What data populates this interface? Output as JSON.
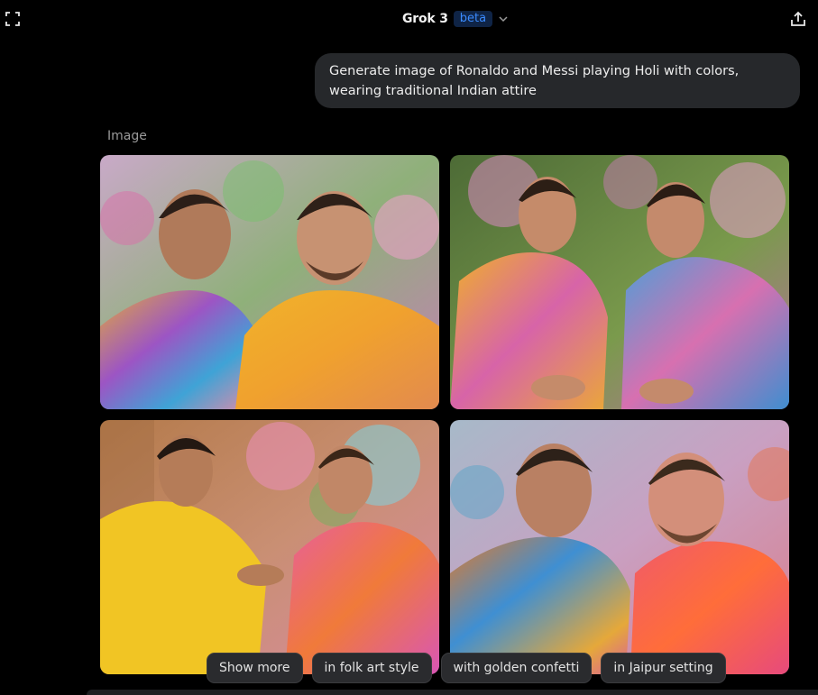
{
  "header": {
    "model_name": "Grok 3",
    "badge": "beta",
    "icons": {
      "expand": "expand-icon",
      "chevron": "chevron-down-icon",
      "share": "share-icon"
    }
  },
  "conversation": {
    "user_message": "Generate image of Ronaldo and Messi playing Holi with colors, wearing traditional Indian attire",
    "response_label": "Image"
  },
  "images": [
    {
      "name": "generated-image-1"
    },
    {
      "name": "generated-image-2"
    },
    {
      "name": "generated-image-3"
    },
    {
      "name": "generated-image-4"
    }
  ],
  "suggestions": [
    "Show more",
    "in folk art style",
    "with golden confetti",
    "in Jaipur setting"
  ],
  "colors": {
    "background": "#000000",
    "bubble": "#26282b",
    "chip": "#2a2b2e",
    "badge_text": "#3a8bff",
    "badge_bg": "#0f2446"
  }
}
